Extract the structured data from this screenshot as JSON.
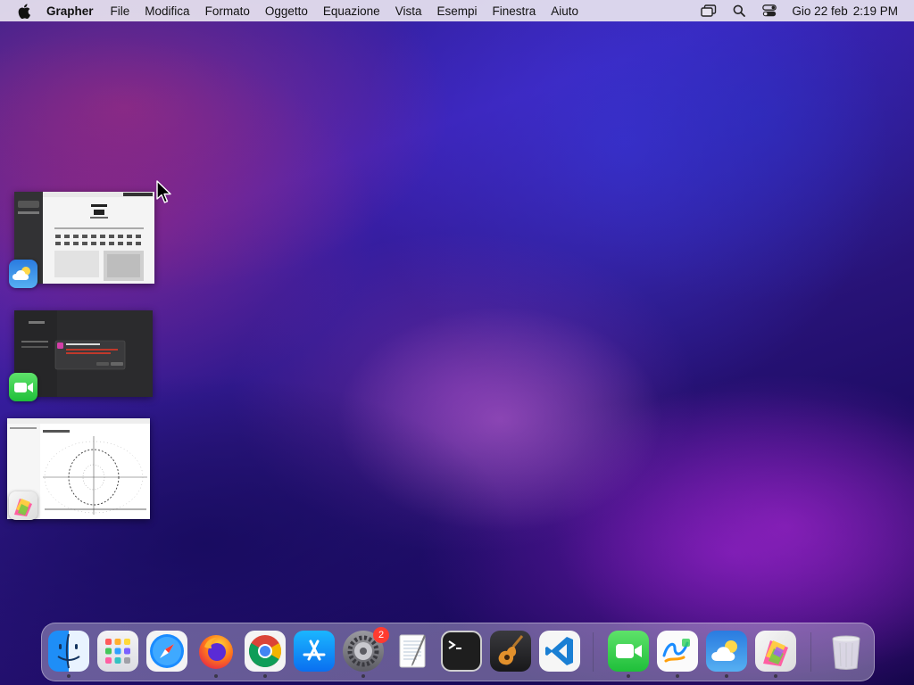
{
  "menubar": {
    "apple_icon": "apple-icon",
    "app_name": "Grapher",
    "items": [
      "File",
      "Modifica",
      "Formato",
      "Oggetto",
      "Equazione",
      "Vista",
      "Esempi",
      "Finestra",
      "Aiuto"
    ],
    "status_icons": [
      "stage-manager-icon",
      "spotlight-search-icon",
      "control-center-icon"
    ],
    "date": "Gio 22 feb",
    "time": "2:19 PM"
  },
  "stage_manager": {
    "windows": [
      {
        "app": "Weather",
        "icon": "weather-icon"
      },
      {
        "app": "FaceTime",
        "icon": "facetime-icon"
      },
      {
        "app": "Grapher",
        "icon": "grapher-icon"
      }
    ]
  },
  "dock": {
    "apps": [
      {
        "name": "Finder",
        "icon": "finder-icon",
        "running": true
      },
      {
        "name": "Launchpad",
        "icon": "launchpad-icon",
        "running": false
      },
      {
        "name": "Safari",
        "icon": "safari-icon",
        "running": false
      },
      {
        "name": "Firefox",
        "icon": "firefox-icon",
        "running": true
      },
      {
        "name": "Google Chrome",
        "icon": "chrome-icon",
        "running": true
      },
      {
        "name": "App Store",
        "icon": "app-store-icon",
        "running": false
      },
      {
        "name": "Impostazioni di Sistema",
        "icon": "system-settings-icon",
        "running": true,
        "badge": "2"
      },
      {
        "name": "TextEdit",
        "icon": "textedit-icon",
        "running": false
      },
      {
        "name": "Terminale",
        "icon": "terminal-icon",
        "running": false
      },
      {
        "name": "GarageBand",
        "icon": "garageband-icon",
        "running": false
      },
      {
        "name": "Visual Studio Code",
        "icon": "vscode-icon",
        "running": false
      },
      {
        "name": "FaceTime",
        "icon": "facetime-icon",
        "running": true
      },
      {
        "name": "Freeform",
        "icon": "freeform-icon",
        "running": true
      },
      {
        "name": "Meteo",
        "icon": "weather-icon",
        "running": true
      },
      {
        "name": "Grapher",
        "icon": "grapher-icon",
        "running": true
      },
      {
        "name": "Cestino",
        "icon": "trash-icon",
        "running": false
      }
    ]
  }
}
